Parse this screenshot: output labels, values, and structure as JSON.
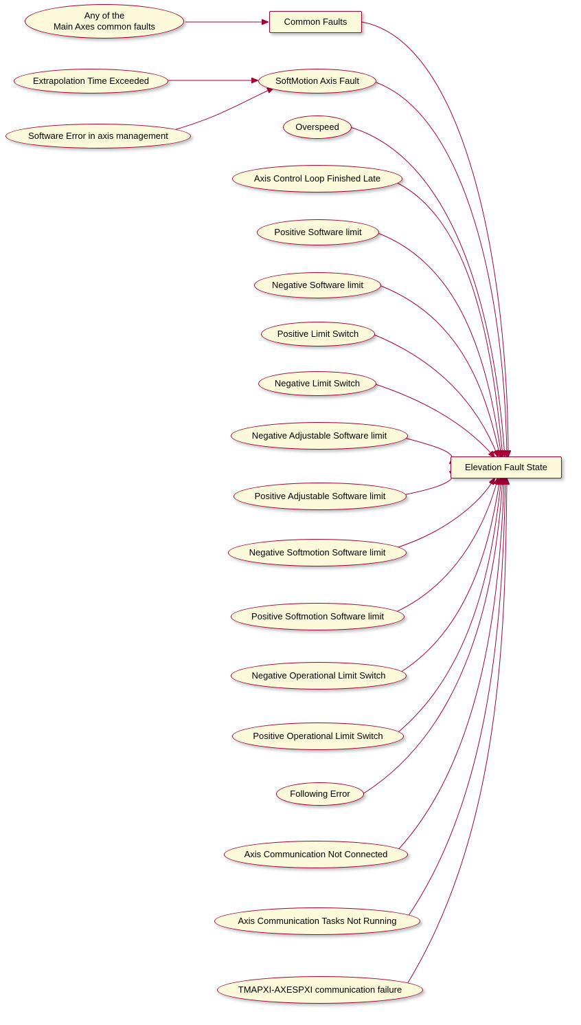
{
  "colors": {
    "nodeFill": "#fdfadb",
    "nodeStroke": "#a80035",
    "edge": "#a80035"
  },
  "nodes": {
    "any_common": {
      "label": "Any of the\nMain Axes common faults",
      "shape": "ellipse"
    },
    "common_faults": {
      "label": "Common Faults",
      "shape": "rect"
    },
    "extrapolation": {
      "label": "Extrapolation Time Exceeded",
      "shape": "ellipse"
    },
    "softmotion_fault": {
      "label": "SoftMotion Axis Fault",
      "shape": "ellipse"
    },
    "software_error": {
      "label": "Software Error in axis management",
      "shape": "ellipse"
    },
    "overspeed": {
      "label": "Overspeed",
      "shape": "ellipse"
    },
    "axis_loop_late": {
      "label": "Axis Control Loop Finished Late",
      "shape": "ellipse"
    },
    "pos_sw_limit": {
      "label": "Positive Software limit",
      "shape": "ellipse"
    },
    "neg_sw_limit": {
      "label": "Negative Software limit",
      "shape": "ellipse"
    },
    "pos_limit_sw": {
      "label": "Positive Limit Switch",
      "shape": "ellipse"
    },
    "neg_limit_sw": {
      "label": "Negative Limit Switch",
      "shape": "ellipse"
    },
    "neg_adj_sw": {
      "label": "Negative Adjustable Software limit",
      "shape": "ellipse"
    },
    "pos_adj_sw": {
      "label": "Positive Adjustable Software limit",
      "shape": "ellipse"
    },
    "neg_sm_sw": {
      "label": "Negative Softmotion Software limit",
      "shape": "ellipse"
    },
    "pos_sm_sw": {
      "label": "Positive Softmotion Software limit",
      "shape": "ellipse"
    },
    "neg_op_ls": {
      "label": "Negative Operational Limit Switch",
      "shape": "ellipse"
    },
    "pos_op_ls": {
      "label": "Positive Operational Limit Switch",
      "shape": "ellipse"
    },
    "following_err": {
      "label": "Following Error",
      "shape": "ellipse"
    },
    "axis_comm_nc": {
      "label": "Axis Communication Not Connected",
      "shape": "ellipse"
    },
    "axis_comm_nr": {
      "label": "Axis Communication Tasks Not Running",
      "shape": "ellipse"
    },
    "tmapxi": {
      "label": "TMAPXI-AXESPXI communication failure",
      "shape": "ellipse"
    },
    "elevation_fault": {
      "label": "Elevation Fault State",
      "shape": "rect"
    }
  },
  "edges": [
    {
      "from": "any_common",
      "to": "common_faults"
    },
    {
      "from": "extrapolation",
      "to": "softmotion_fault"
    },
    {
      "from": "software_error",
      "to": "softmotion_fault"
    },
    {
      "from": "common_faults",
      "to": "elevation_fault"
    },
    {
      "from": "softmotion_fault",
      "to": "elevation_fault"
    },
    {
      "from": "overspeed",
      "to": "elevation_fault"
    },
    {
      "from": "axis_loop_late",
      "to": "elevation_fault"
    },
    {
      "from": "pos_sw_limit",
      "to": "elevation_fault"
    },
    {
      "from": "neg_sw_limit",
      "to": "elevation_fault"
    },
    {
      "from": "pos_limit_sw",
      "to": "elevation_fault"
    },
    {
      "from": "neg_limit_sw",
      "to": "elevation_fault"
    },
    {
      "from": "neg_adj_sw",
      "to": "elevation_fault"
    },
    {
      "from": "pos_adj_sw",
      "to": "elevation_fault"
    },
    {
      "from": "neg_sm_sw",
      "to": "elevation_fault"
    },
    {
      "from": "pos_sm_sw",
      "to": "elevation_fault"
    },
    {
      "from": "neg_op_ls",
      "to": "elevation_fault"
    },
    {
      "from": "pos_op_ls",
      "to": "elevation_fault"
    },
    {
      "from": "following_err",
      "to": "elevation_fault"
    },
    {
      "from": "axis_comm_nc",
      "to": "elevation_fault"
    },
    {
      "from": "axis_comm_nr",
      "to": "elevation_fault"
    },
    {
      "from": "tmapxi",
      "to": "elevation_fault"
    }
  ]
}
